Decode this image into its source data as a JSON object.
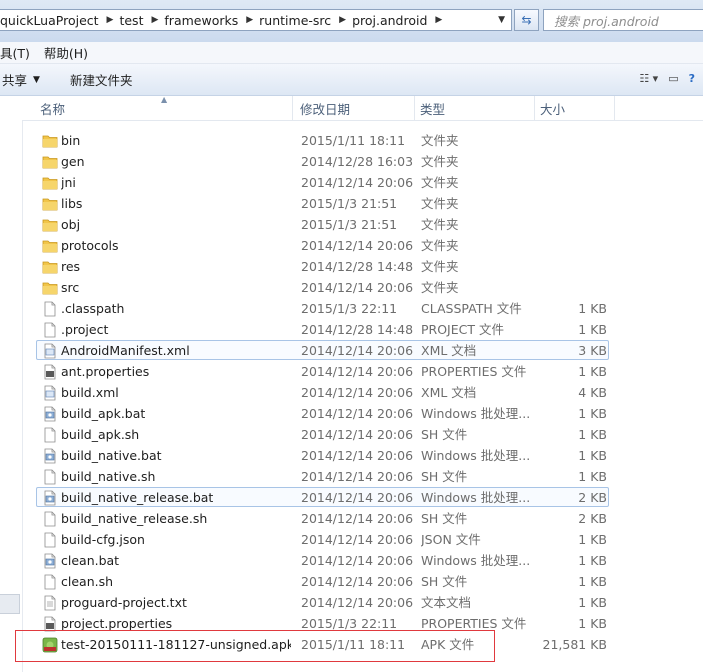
{
  "address": {
    "crumbs": [
      "quickLuaProject",
      "test",
      "frameworks",
      "runtime-src",
      "proj.android"
    ],
    "search_placeholder": "搜索 proj.android"
  },
  "menu": [
    "具(T)",
    "帮助(H)"
  ],
  "commands": {
    "share": "共享",
    "new_folder": "新建文件夹"
  },
  "columns": {
    "name": "名称",
    "date": "修改日期",
    "type": "类型",
    "size": "大小"
  },
  "files": [
    {
      "name": "bin",
      "date": "2015/1/11 18:11",
      "type": "文件夹",
      "size": "",
      "icon": "folder-icon"
    },
    {
      "name": "gen",
      "date": "2014/12/28 16:03",
      "type": "文件夹",
      "size": "",
      "icon": "folder-icon"
    },
    {
      "name": "jni",
      "date": "2014/12/14 20:06",
      "type": "文件夹",
      "size": "",
      "icon": "folder-icon"
    },
    {
      "name": "libs",
      "date": "2015/1/3 21:51",
      "type": "文件夹",
      "size": "",
      "icon": "folder-icon"
    },
    {
      "name": "obj",
      "date": "2015/1/3 21:51",
      "type": "文件夹",
      "size": "",
      "icon": "folder-icon"
    },
    {
      "name": "protocols",
      "date": "2014/12/14 20:06",
      "type": "文件夹",
      "size": "",
      "icon": "folder-icon"
    },
    {
      "name": "res",
      "date": "2014/12/28 14:48",
      "type": "文件夹",
      "size": "",
      "icon": "folder-icon"
    },
    {
      "name": "src",
      "date": "2014/12/14 20:06",
      "type": "文件夹",
      "size": "",
      "icon": "folder-icon"
    },
    {
      "name": ".classpath",
      "date": "2015/1/3 22:11",
      "type": "CLASSPATH 文件",
      "size": "1 KB",
      "icon": "blank-file-icon"
    },
    {
      "name": ".project",
      "date": "2014/12/28 14:48",
      "type": "PROJECT 文件",
      "size": "1 KB",
      "icon": "blank-file-icon"
    },
    {
      "name": "AndroidManifest.xml",
      "date": "2014/12/14 20:06",
      "type": "XML 文档",
      "size": "3 KB",
      "icon": "xml-file-icon",
      "highlight": true
    },
    {
      "name": "ant.properties",
      "date": "2014/12/14 20:06",
      "type": "PROPERTIES 文件",
      "size": "1 KB",
      "icon": "properties-file-icon"
    },
    {
      "name": "build.xml",
      "date": "2014/12/14 20:06",
      "type": "XML 文档",
      "size": "4 KB",
      "icon": "xml-file-icon"
    },
    {
      "name": "build_apk.bat",
      "date": "2014/12/14 20:06",
      "type": "Windows 批处理...",
      "size": "1 KB",
      "icon": "bat-file-icon"
    },
    {
      "name": "build_apk.sh",
      "date": "2014/12/14 20:06",
      "type": "SH 文件",
      "size": "1 KB",
      "icon": "blank-file-icon"
    },
    {
      "name": "build_native.bat",
      "date": "2014/12/14 20:06",
      "type": "Windows 批处理...",
      "size": "1 KB",
      "icon": "bat-file-icon"
    },
    {
      "name": "build_native.sh",
      "date": "2014/12/14 20:06",
      "type": "SH 文件",
      "size": "1 KB",
      "icon": "blank-file-icon"
    },
    {
      "name": "build_native_release.bat",
      "date": "2014/12/14 20:06",
      "type": "Windows 批处理...",
      "size": "2 KB",
      "icon": "bat-file-icon",
      "highlight": true
    },
    {
      "name": "build_native_release.sh",
      "date": "2014/12/14 20:06",
      "type": "SH 文件",
      "size": "2 KB",
      "icon": "blank-file-icon"
    },
    {
      "name": "build-cfg.json",
      "date": "2014/12/14 20:06",
      "type": "JSON 文件",
      "size": "1 KB",
      "icon": "blank-file-icon"
    },
    {
      "name": "clean.bat",
      "date": "2014/12/14 20:06",
      "type": "Windows 批处理...",
      "size": "1 KB",
      "icon": "bat-file-icon"
    },
    {
      "name": "clean.sh",
      "date": "2014/12/14 20:06",
      "type": "SH 文件",
      "size": "1 KB",
      "icon": "blank-file-icon"
    },
    {
      "name": "proguard-project.txt",
      "date": "2014/12/14 20:06",
      "type": "文本文档",
      "size": "1 KB",
      "icon": "text-file-icon"
    },
    {
      "name": "project.properties",
      "date": "2015/1/3 22:11",
      "type": "PROPERTIES 文件",
      "size": "1 KB",
      "icon": "properties-file-icon"
    },
    {
      "name": "test-20150111-181127-unsigned.apk",
      "date": "2015/1/11 18:11",
      "type": "APK 文件",
      "size": "21,581 KB",
      "icon": "apk-file-icon"
    }
  ],
  "colors": {
    "folder": "#e8b630",
    "selection_box": "#e0393e",
    "hover_border": "#a8c4e6"
  }
}
